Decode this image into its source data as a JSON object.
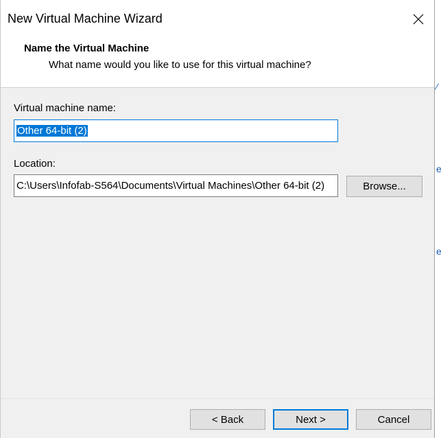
{
  "window": {
    "title": "New Virtual Machine Wizard"
  },
  "header": {
    "title": "Name the Virtual Machine",
    "subtitle": "What name would you like to use for this virtual machine?"
  },
  "form": {
    "name_label": "Virtual machine name:",
    "name_value": "Other 64-bit (2)",
    "location_label": "Location:",
    "location_value": "C:\\Users\\Infofab-S564\\Documents\\Virtual Machines\\Other 64-bit (2)",
    "browse_label": "Browse..."
  },
  "footer": {
    "back_label": "< Back",
    "next_label": "Next >",
    "cancel_label": "Cancel"
  },
  "colors": {
    "accent": "#0078d7",
    "dialog_bg": "#f0f0f0",
    "button_bg": "#e1e1e1"
  }
}
